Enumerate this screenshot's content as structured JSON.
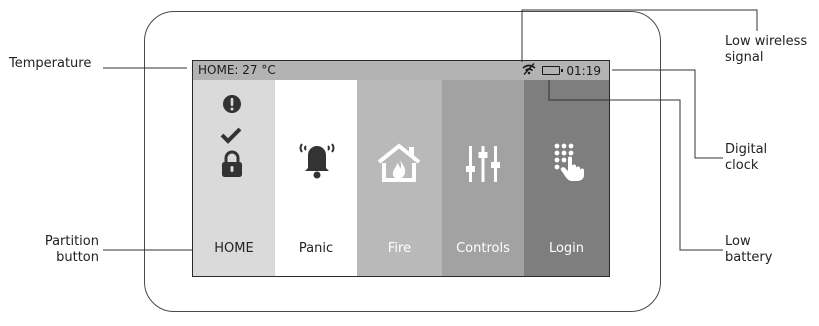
{
  "status_bar": {
    "temperature_text": "HOME: 27 °C",
    "clock": "01:19"
  },
  "tiles": [
    {
      "id": "home",
      "label": "HOME"
    },
    {
      "id": "panic",
      "label": "Panic"
    },
    {
      "id": "fire",
      "label": "Fire"
    },
    {
      "id": "controls",
      "label": "Controls"
    },
    {
      "id": "login",
      "label": "Login"
    }
  ],
  "callouts": {
    "temperature": "Temperature",
    "partition_button_line1": "Partition",
    "partition_button_line2": "button",
    "low_wireless_line1": "Low wireless",
    "low_wireless_line2": "signal",
    "digital_clock_line1": "Digital",
    "digital_clock_line2": "clock",
    "low_battery_line1": "Low",
    "low_battery_line2": "battery"
  },
  "icons": {
    "home_tile": [
      "exclamation-icon",
      "check-icon",
      "lock-icon"
    ],
    "panic_tile": "bell-icon",
    "fire_tile": "house-fire-icon",
    "controls_tile": "sliders-icon",
    "login_tile": "keypad-touch-icon",
    "status": [
      "wireless-signal-icon",
      "battery-icon"
    ]
  },
  "colors": {
    "status_bar": "#b3b3b3",
    "home_tile": "#dadada",
    "panic_tile": "#ffffff",
    "fire_tile": "#b9b9b9",
    "controls_tile": "#a2a2a2",
    "login_tile": "#7e7e7e"
  }
}
